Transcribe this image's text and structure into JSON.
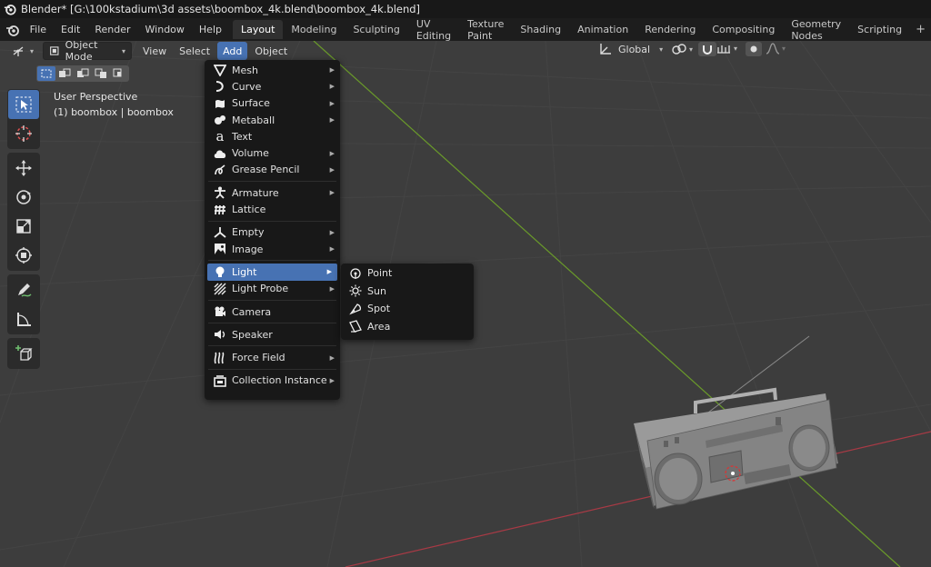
{
  "window": {
    "title": "Blender* [G:\\100kstadium\\3d assets\\boombox_4k.blend\\boombox_4k.blend]"
  },
  "top_menu": [
    "File",
    "Edit",
    "Render",
    "Window",
    "Help"
  ],
  "workspace_tabs": [
    "Layout",
    "Modeling",
    "Sculpting",
    "UV Editing",
    "Texture Paint",
    "Shading",
    "Animation",
    "Rendering",
    "Compositing",
    "Geometry Nodes",
    "Scripting"
  ],
  "active_tab": "Layout",
  "viewport_header": {
    "mode": "Object Mode",
    "menus": [
      "View",
      "Select",
      "Add",
      "Object"
    ],
    "active_menu": "Add",
    "orientation": "Global"
  },
  "viewport_overlay": {
    "perspective": "User Perspective",
    "object_info": "(1) boombox | boombox"
  },
  "add_menu": {
    "items": [
      {
        "label": "Mesh",
        "icon": "mesh-icon",
        "submenu": true
      },
      {
        "label": "Curve",
        "icon": "curve-icon",
        "submenu": true
      },
      {
        "label": "Surface",
        "icon": "surface-icon",
        "submenu": true
      },
      {
        "label": "Metaball",
        "icon": "metaball-icon",
        "submenu": true
      },
      {
        "label": "Text",
        "icon": "text-icon",
        "submenu": false
      },
      {
        "label": "Volume",
        "icon": "volume-icon",
        "submenu": true
      },
      {
        "label": "Grease Pencil",
        "icon": "grease-pencil-icon",
        "submenu": true
      },
      {
        "label": "Armature",
        "icon": "armature-icon",
        "submenu": true
      },
      {
        "label": "Lattice",
        "icon": "lattice-icon",
        "submenu": false
      },
      {
        "label": "Empty",
        "icon": "empty-icon",
        "submenu": true
      },
      {
        "label": "Image",
        "icon": "image-icon",
        "submenu": true
      },
      {
        "label": "Light",
        "icon": "light-icon",
        "submenu": true
      },
      {
        "label": "Light Probe",
        "icon": "light-probe-icon",
        "submenu": true
      },
      {
        "label": "Camera",
        "icon": "camera-icon",
        "submenu": false
      },
      {
        "label": "Speaker",
        "icon": "speaker-icon",
        "submenu": false
      },
      {
        "label": "Force Field",
        "icon": "force-field-icon",
        "submenu": true
      },
      {
        "label": "Collection Instance",
        "icon": "collection-instance-icon",
        "submenu": true
      }
    ],
    "highlighted": "Light"
  },
  "light_submenu": {
    "items": [
      {
        "label": "Point",
        "icon": "point-light-icon"
      },
      {
        "label": "Sun",
        "icon": "sun-light-icon"
      },
      {
        "label": "Spot",
        "icon": "spot-light-icon"
      },
      {
        "label": "Area",
        "icon": "area-light-icon"
      }
    ]
  },
  "colors": {
    "accent": "#4772b3",
    "menu_bg": "#181818",
    "viewport_bg": "#3d3d3d",
    "x_axis": "#a83a45",
    "y_axis": "#6a9a2a"
  }
}
